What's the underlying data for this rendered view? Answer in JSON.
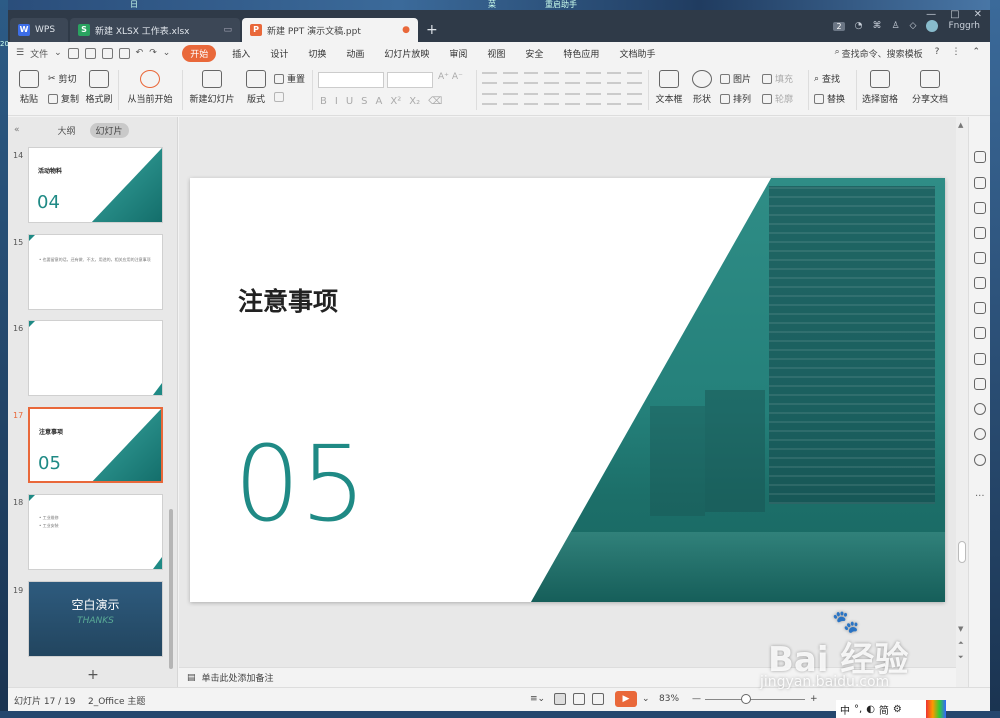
{
  "desktop": {
    "top_text_1": "日",
    "top_text_2": "菜",
    "top_text_3": "重启助手",
    "side_text": "20"
  },
  "tabs": {
    "wps": "WPS",
    "xlsx": "新建 XLSX 工作表.xlsx",
    "ppt": "新建 PPT 演示文稿.ppt",
    "add": "+"
  },
  "title_right": {
    "count": "2",
    "user": "Fnggrh"
  },
  "window_controls": {
    "min": "—",
    "max": "□",
    "close": "✕"
  },
  "menu": {
    "file": "文件",
    "items": [
      "开始",
      "插入",
      "设计",
      "切换",
      "动画",
      "幻灯片放映",
      "审阅",
      "视图",
      "安全",
      "特色应用",
      "文档助手"
    ],
    "search": "查找命令、搜索模板",
    "help": "?"
  },
  "ribbon": {
    "paste": "粘贴",
    "cut": "剪切",
    "copy": "复制",
    "format_painter": "格式刷",
    "play_from_current": "从当前开始",
    "new_slide": "新建幻灯片",
    "layout": "版式",
    "reset": "重置",
    "text_box": "文本框",
    "shape": "形状",
    "picture": "图片",
    "fill": "填充",
    "arrange": "排列",
    "outline": "轮廓",
    "find": "查找",
    "replace": "替换",
    "selection_pane": "选择窗格",
    "share_doc": "分享文档",
    "font_btns": [
      "B",
      "I",
      "U",
      "S",
      "A",
      "X²",
      "X₂"
    ]
  },
  "panel": {
    "outline_tab": "大纲",
    "slides_tab": "幻灯片",
    "collapse": "«",
    "add": "+"
  },
  "slides": [
    {
      "num": "14",
      "title": "活动物料",
      "number": "04"
    },
    {
      "num": "15",
      "line": "• 也要留意的话，还有做、不太，用途的，相关应用的注意事项"
    },
    {
      "num": "16"
    },
    {
      "num": "17",
      "title": "注意事项",
      "number": "05"
    },
    {
      "num": "18",
      "line1": "• 工业维修",
      "line2": "• 工业安装"
    },
    {
      "num": "19",
      "title": "空白演示",
      "subtitle": "THANKS"
    }
  ],
  "current_slide": {
    "title": "注意事项",
    "number": "05"
  },
  "notes": {
    "placeholder": "单击此处添加备注"
  },
  "status": {
    "slide_info": "幻灯片 17 / 19",
    "theme": "2_Office 主题",
    "zoom": "83%",
    "zoom_minus": "—",
    "zoom_plus": "+"
  },
  "watermark": {
    "text": "Bai 经验",
    "url": "jingyan.baidu.com"
  },
  "ime": {
    "mode": "中",
    "simp": "简"
  },
  "colors": {
    "accent": "#e9683a",
    "teal": "#1f8a85",
    "titlebar": "#2f3a48"
  }
}
